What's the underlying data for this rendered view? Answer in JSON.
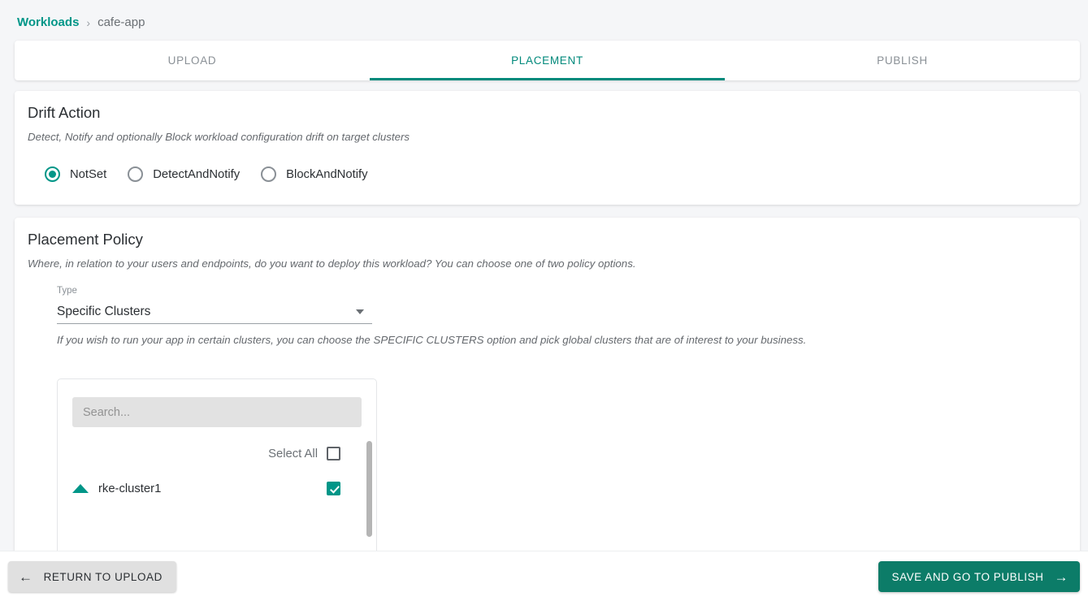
{
  "breadcrumb": {
    "root": "Workloads",
    "separator": "›",
    "current": "cafe-app"
  },
  "tabs": [
    {
      "label": "UPLOAD",
      "active": false
    },
    {
      "label": "PLACEMENT",
      "active": true
    },
    {
      "label": "PUBLISH",
      "active": false
    }
  ],
  "drift_action": {
    "title": "Drift Action",
    "description": "Detect, Notify and optionally Block workload configuration drift on target clusters",
    "options": [
      {
        "label": "NotSet",
        "selected": true
      },
      {
        "label": "DetectAndNotify",
        "selected": false
      },
      {
        "label": "BlockAndNotify",
        "selected": false
      }
    ]
  },
  "placement_policy": {
    "title": "Placement Policy",
    "description": "Where, in relation to your users and endpoints, do you want to deploy this workload? You can choose one of two policy options.",
    "type_field": {
      "label": "Type",
      "value": "Specific Clusters"
    },
    "hint": "If you wish to run your app in certain clusters, you can choose the SPECIFIC CLUSTERS option and pick global clusters that are of interest to your business.",
    "cluster_picker": {
      "search_placeholder": "Search...",
      "search_value": "",
      "select_all_label": "Select All",
      "select_all_checked": false,
      "clusters": [
        {
          "name": "rke-cluster1",
          "checked": true,
          "expanded": true
        }
      ]
    }
  },
  "footer": {
    "back_label": "RETURN TO UPLOAD",
    "back_arrow": "←",
    "next_label": "SAVE AND GO TO PUBLISH",
    "next_arrow": "→"
  },
  "colors": {
    "accent_teal": "#009688",
    "tab_teal": "#00897b",
    "button_teal": "#0c7c68",
    "page_bg": "#f5f6f8"
  }
}
